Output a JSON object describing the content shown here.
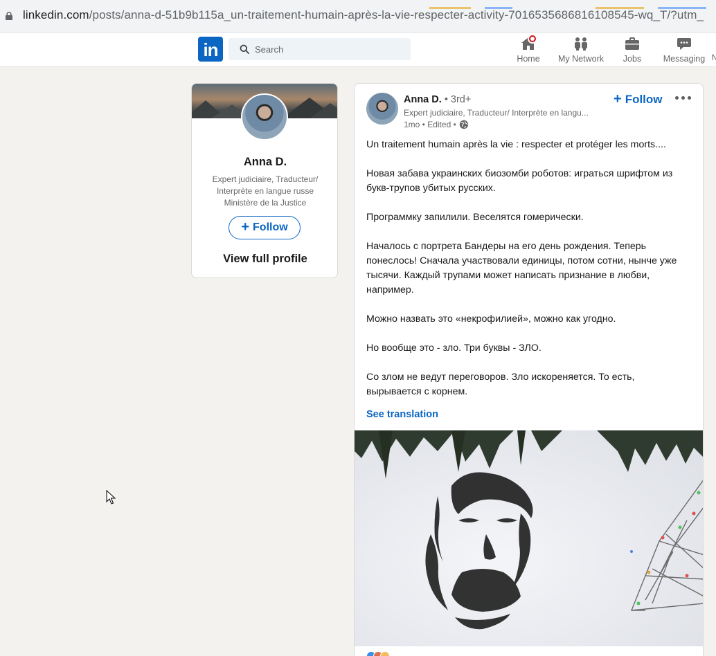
{
  "browser": {
    "url_host": "linkedin.com",
    "url_path": "/posts/anna-d-51b9b115a_un-traitement-humain-après-la-vie-respecter-activity-7016535686816108545-wq_T/?utm_"
  },
  "nav": {
    "logo": "in",
    "search_placeholder": "Search",
    "items": [
      {
        "label": "Home",
        "icon": "home-icon"
      },
      {
        "label": "My Network",
        "icon": "network-icon"
      },
      {
        "label": "Jobs",
        "icon": "briefcase-icon"
      },
      {
        "label": "Messaging",
        "icon": "messaging-icon"
      },
      {
        "label": "N"
      }
    ]
  },
  "profile_card": {
    "name": "Anna D.",
    "headline": "Expert judiciaire, Traducteur/ Interprète en langue russe Ministère de la Justice",
    "follow_label": "Follow",
    "view_profile_label": "View full profile"
  },
  "post": {
    "author": "Anna D.",
    "degree": "• 3rd+",
    "headline": "Expert judiciaire, Traducteur/ Interprète en langu...",
    "meta": "1mo • Edited •",
    "follow_label": "Follow",
    "paragraphs": [
      "Un traitement humain après la vie : respecter et protéger les morts....",
      "Новая забава украинских биозомби роботов: играться шрифтом из букв-трупов убитых русских.",
      "Программку запилили. Веселятся гомерически.",
      "Началось с портрета Бандеры на его день рождения. Теперь понеслось! Сначала участвовали единицы, потом сотни, нынче уже тысячи. Каждый трупами может написать признание в любви, например.",
      "Можно назвать это «некрофилией», можно как угодно.",
      "Но вообще это - зло. Три буквы - ЗЛО.",
      "Со злом не ведут переговоров. Зло искореняется. То есть, вырывается с корнем."
    ],
    "see_translation": "See translation"
  },
  "colors": {
    "brand": "#0a66c2",
    "page_bg": "#f3f2ef",
    "notification": "#cc1016"
  }
}
